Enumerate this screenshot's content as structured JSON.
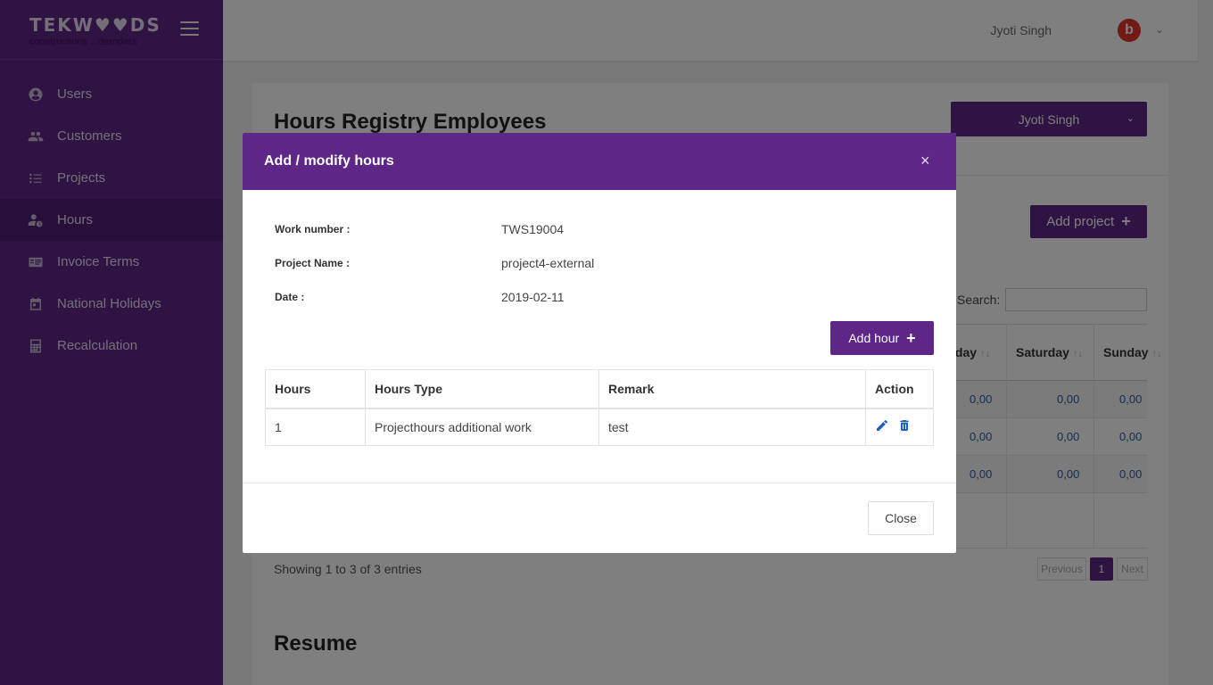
{
  "brand": {
    "logo": "TEKW♥♥DS",
    "tagline": "constructions ...dernders"
  },
  "sidebar": {
    "items": [
      {
        "label": "Users",
        "icon": "user-circle-icon"
      },
      {
        "label": "Customers",
        "icon": "people-icon"
      },
      {
        "label": "Projects",
        "icon": "checklist-icon"
      },
      {
        "label": "Hours",
        "icon": "user-clock-icon",
        "active": true
      },
      {
        "label": "Invoice Terms",
        "icon": "invoice-icon"
      },
      {
        "label": "National Holidays",
        "icon": "calendar-icon"
      },
      {
        "label": "Recalculation",
        "icon": "calculator-icon"
      }
    ]
  },
  "topbar": {
    "user_name": "Jyoti Singh",
    "avatar_letter": "b"
  },
  "page": {
    "title": "Hours Registry Employees",
    "employee_select": "Jyoti Singh",
    "add_project": "Add project",
    "search_label": "Search:",
    "columns": [
      "iday",
      "Saturday",
      "Sunday"
    ],
    "rows": [
      [
        "0,00",
        "0,00",
        "0,00"
      ],
      [
        "0,00",
        "0,00",
        "0,00"
      ],
      [
        "0,00",
        "0,00",
        "0,00"
      ]
    ],
    "showing": "Showing 1 to 3 of 3 entries",
    "pagination": {
      "previous": "Previous",
      "current": "1",
      "next": "Next"
    },
    "resume_title": "Resume"
  },
  "modal": {
    "title": "Add / modify hours",
    "close_symbol": "×",
    "work_number_label": "Work number :",
    "work_number": "TWS19004",
    "project_name_label": "Project Name :",
    "project_name": "project4-external",
    "date_label": "Date :",
    "date": "2019-02-11",
    "add_hour": "Add hour",
    "table": {
      "headers": [
        "Hours",
        "Hours Type",
        "Remark",
        "Action"
      ],
      "rows": [
        {
          "hours": "1",
          "type": "Projecthours additional work",
          "remark": "test"
        }
      ]
    },
    "close_button": "Close"
  },
  "colors": {
    "primary": "#5d2687",
    "link": "#2b59a8",
    "avatar": "#e0322b"
  }
}
